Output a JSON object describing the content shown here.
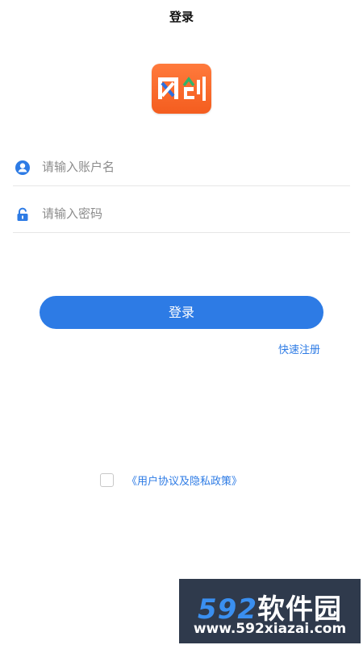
{
  "header": {
    "title": "登录"
  },
  "logo": {
    "alt_text": "网创"
  },
  "form": {
    "username_placeholder": "请输入账户名",
    "password_placeholder": "请输入密码",
    "username_icon": "user-icon",
    "password_icon": "lock-icon"
  },
  "login_button_label": "登录",
  "register_link_label": "快速注册",
  "agreement": {
    "checked": false,
    "link_label": "《用户协议及隐私政策》"
  },
  "watermark": {
    "number": "592",
    "name": "软件园",
    "url": "www.592xiazai.com"
  },
  "colors": {
    "accent": "#2d7be5",
    "logo_orange": "#f45d1f",
    "watermark_bg": "#2f3a4c"
  }
}
